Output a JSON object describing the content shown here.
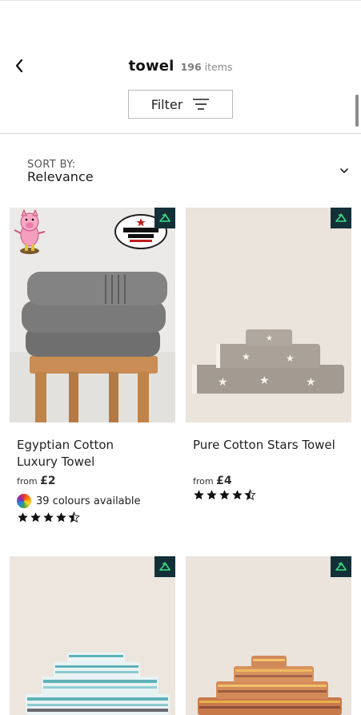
{
  "header": {
    "title": "towel",
    "count": "196",
    "count_suffix": "items"
  },
  "filter": {
    "label": "Filter"
  },
  "sort": {
    "label": "SORT BY:",
    "value": "Relevance"
  },
  "products": [
    {
      "name_line1": "Egyptian Cotton",
      "name_line2": "Luxury Towel",
      "price_prefix": "from",
      "price": "£2",
      "colours_text": "39 colours available",
      "rating": 4.5,
      "badge_text": "Good Housekeeping Institute APPROVED 2021"
    },
    {
      "name_line1": "Pure Cotton Stars Towel",
      "name_line2": "",
      "price_prefix": "from",
      "price": "£4",
      "rating": 4.5
    },
    {
      "name_line1": "",
      "name_line2": ""
    },
    {
      "name_line1": "",
      "name_line2": ""
    }
  ],
  "icons": {
    "back": "chevron-left-icon",
    "filter": "filter-lines-icon",
    "sort": "chevron-down-icon",
    "badge": "hanger-icon"
  },
  "colors": {
    "badge_bg": "#133038",
    "badge_icon": "#3ddc84"
  }
}
